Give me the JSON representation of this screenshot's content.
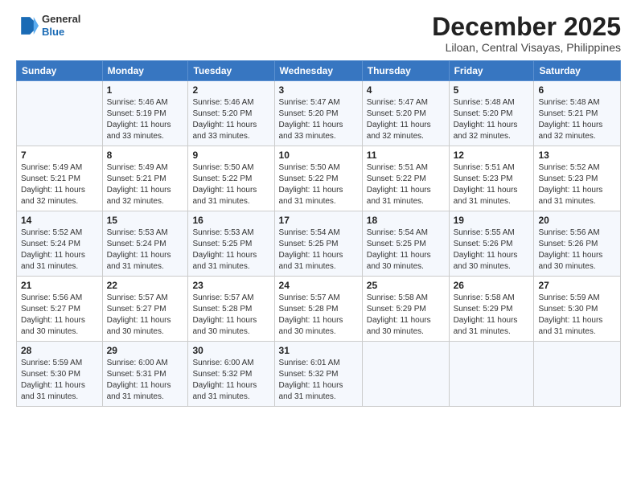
{
  "header": {
    "logo_line1": "General",
    "logo_line2": "Blue",
    "title": "December 2025",
    "subtitle": "Liloan, Central Visayas, Philippines"
  },
  "columns": [
    "Sunday",
    "Monday",
    "Tuesday",
    "Wednesday",
    "Thursday",
    "Friday",
    "Saturday"
  ],
  "weeks": [
    [
      {
        "day": "",
        "info": ""
      },
      {
        "day": "1",
        "info": "Sunrise: 5:46 AM\nSunset: 5:19 PM\nDaylight: 11 hours\nand 33 minutes."
      },
      {
        "day": "2",
        "info": "Sunrise: 5:46 AM\nSunset: 5:20 PM\nDaylight: 11 hours\nand 33 minutes."
      },
      {
        "day": "3",
        "info": "Sunrise: 5:47 AM\nSunset: 5:20 PM\nDaylight: 11 hours\nand 33 minutes."
      },
      {
        "day": "4",
        "info": "Sunrise: 5:47 AM\nSunset: 5:20 PM\nDaylight: 11 hours\nand 32 minutes."
      },
      {
        "day": "5",
        "info": "Sunrise: 5:48 AM\nSunset: 5:20 PM\nDaylight: 11 hours\nand 32 minutes."
      },
      {
        "day": "6",
        "info": "Sunrise: 5:48 AM\nSunset: 5:21 PM\nDaylight: 11 hours\nand 32 minutes."
      }
    ],
    [
      {
        "day": "7",
        "info": "Sunrise: 5:49 AM\nSunset: 5:21 PM\nDaylight: 11 hours\nand 32 minutes."
      },
      {
        "day": "8",
        "info": "Sunrise: 5:49 AM\nSunset: 5:21 PM\nDaylight: 11 hours\nand 32 minutes."
      },
      {
        "day": "9",
        "info": "Sunrise: 5:50 AM\nSunset: 5:22 PM\nDaylight: 11 hours\nand 31 minutes."
      },
      {
        "day": "10",
        "info": "Sunrise: 5:50 AM\nSunset: 5:22 PM\nDaylight: 11 hours\nand 31 minutes."
      },
      {
        "day": "11",
        "info": "Sunrise: 5:51 AM\nSunset: 5:22 PM\nDaylight: 11 hours\nand 31 minutes."
      },
      {
        "day": "12",
        "info": "Sunrise: 5:51 AM\nSunset: 5:23 PM\nDaylight: 11 hours\nand 31 minutes."
      },
      {
        "day": "13",
        "info": "Sunrise: 5:52 AM\nSunset: 5:23 PM\nDaylight: 11 hours\nand 31 minutes."
      }
    ],
    [
      {
        "day": "14",
        "info": "Sunrise: 5:52 AM\nSunset: 5:24 PM\nDaylight: 11 hours\nand 31 minutes."
      },
      {
        "day": "15",
        "info": "Sunrise: 5:53 AM\nSunset: 5:24 PM\nDaylight: 11 hours\nand 31 minutes."
      },
      {
        "day": "16",
        "info": "Sunrise: 5:53 AM\nSunset: 5:25 PM\nDaylight: 11 hours\nand 31 minutes."
      },
      {
        "day": "17",
        "info": "Sunrise: 5:54 AM\nSunset: 5:25 PM\nDaylight: 11 hours\nand 31 minutes."
      },
      {
        "day": "18",
        "info": "Sunrise: 5:54 AM\nSunset: 5:25 PM\nDaylight: 11 hours\nand 30 minutes."
      },
      {
        "day": "19",
        "info": "Sunrise: 5:55 AM\nSunset: 5:26 PM\nDaylight: 11 hours\nand 30 minutes."
      },
      {
        "day": "20",
        "info": "Sunrise: 5:56 AM\nSunset: 5:26 PM\nDaylight: 11 hours\nand 30 minutes."
      }
    ],
    [
      {
        "day": "21",
        "info": "Sunrise: 5:56 AM\nSunset: 5:27 PM\nDaylight: 11 hours\nand 30 minutes."
      },
      {
        "day": "22",
        "info": "Sunrise: 5:57 AM\nSunset: 5:27 PM\nDaylight: 11 hours\nand 30 minutes."
      },
      {
        "day": "23",
        "info": "Sunrise: 5:57 AM\nSunset: 5:28 PM\nDaylight: 11 hours\nand 30 minutes."
      },
      {
        "day": "24",
        "info": "Sunrise: 5:57 AM\nSunset: 5:28 PM\nDaylight: 11 hours\nand 30 minutes."
      },
      {
        "day": "25",
        "info": "Sunrise: 5:58 AM\nSunset: 5:29 PM\nDaylight: 11 hours\nand 30 minutes."
      },
      {
        "day": "26",
        "info": "Sunrise: 5:58 AM\nSunset: 5:29 PM\nDaylight: 11 hours\nand 31 minutes."
      },
      {
        "day": "27",
        "info": "Sunrise: 5:59 AM\nSunset: 5:30 PM\nDaylight: 11 hours\nand 31 minutes."
      }
    ],
    [
      {
        "day": "28",
        "info": "Sunrise: 5:59 AM\nSunset: 5:30 PM\nDaylight: 11 hours\nand 31 minutes."
      },
      {
        "day": "29",
        "info": "Sunrise: 6:00 AM\nSunset: 5:31 PM\nDaylight: 11 hours\nand 31 minutes."
      },
      {
        "day": "30",
        "info": "Sunrise: 6:00 AM\nSunset: 5:32 PM\nDaylight: 11 hours\nand 31 minutes."
      },
      {
        "day": "31",
        "info": "Sunrise: 6:01 AM\nSunset: 5:32 PM\nDaylight: 11 hours\nand 31 minutes."
      },
      {
        "day": "",
        "info": ""
      },
      {
        "day": "",
        "info": ""
      },
      {
        "day": "",
        "info": ""
      }
    ]
  ]
}
